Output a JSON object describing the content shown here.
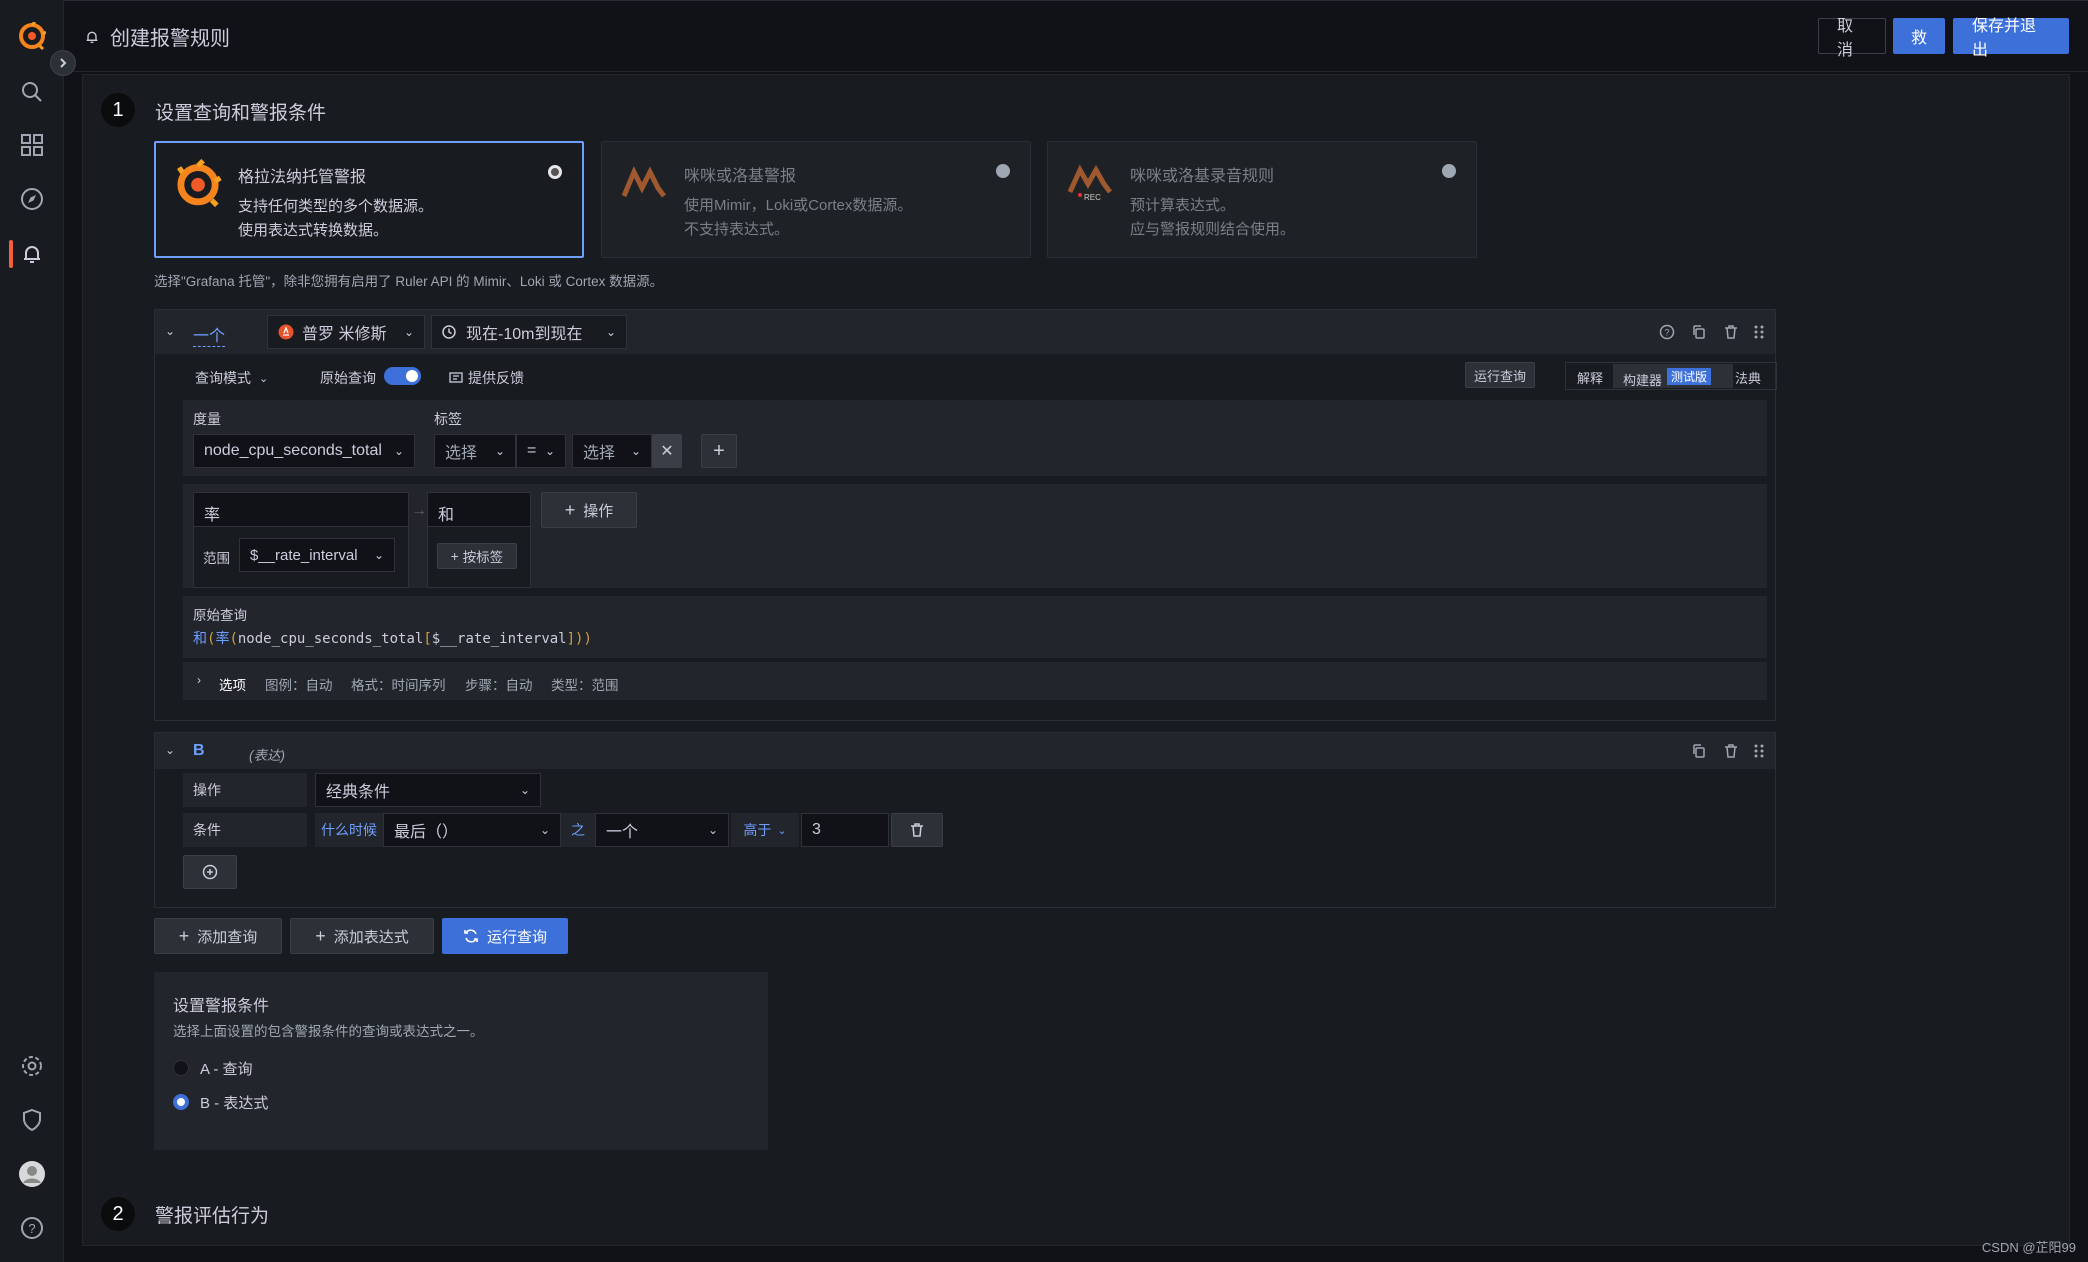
{
  "header": {
    "title": "创建报警规则",
    "cancel_label": "取消",
    "save_label": "救",
    "save_exit_label": "保存并退出"
  },
  "step1": {
    "number": "1",
    "title": "设置查询和警报条件",
    "rule_types": [
      {
        "title": "格拉法纳托管警报",
        "desc1": "支持任何类型的多个数据源。",
        "desc2": "使用表达式转换数据。"
      },
      {
        "title": "咪咪或洛基警报",
        "desc1": "使用Mimir，Loki或Cortex数据源。",
        "desc2": "不支持表达式。"
      },
      {
        "title": "咪咪或洛基录音规则",
        "desc1": "预计算表达式。",
        "desc2": "应与警报规则结合使用。",
        "badge": "REC"
      }
    ],
    "hint": "选择\"Grafana 托管\"，除非您拥有启用了 Ruler API 的 Mimir、Loki 或 Cortex 数据源。"
  },
  "queryA": {
    "name": "一个",
    "datasource": "普罗 米修斯",
    "time_range": "现在-10m到现在",
    "query_mode": "查询模式",
    "raw_query_toggle": "原始查询",
    "feedback": "提供反馈",
    "run_query": "运行查询",
    "explain": "解释",
    "builder": "构建器",
    "beta": "测试版",
    "code": "法典",
    "metric_label": "度量",
    "metric_value": "node_cpu_seconds_total",
    "labels_label": "标签",
    "label_select1": "选择",
    "label_op": "=",
    "label_select2": "选择",
    "op1_name": "率",
    "range_label": "范围",
    "range_value": "$__rate_interval",
    "op2_name": "和",
    "by_label_btn": "按标签",
    "operation_btn": "操作",
    "raw_title": "原始查询",
    "raw_fn_sum": "和",
    "raw_fn_rate": "率",
    "raw_metric": "node_cpu_seconds_total",
    "raw_range": "$__rate_interval",
    "options_label": "选项",
    "opt_legend": "图例：自动",
    "opt_format": "格式：时间序列",
    "opt_step": "步骤：自动",
    "opt_type": "类型：范围"
  },
  "exprB": {
    "name": "B",
    "type_label": "(表达)",
    "operation_label": "操作",
    "operation_value": "经典条件",
    "condition_label": "条件",
    "when": "什么时候",
    "reducer": "最后（）",
    "of": "之",
    "query": "一个",
    "evaluator": "高于",
    "threshold": "3"
  },
  "actions": {
    "add_query": "添加查询",
    "add_expression": "添加表达式",
    "run_queries": "运行查询"
  },
  "condition": {
    "title": "设置警报条件",
    "desc": "选择上面设置的包含警报条件的查询或表达式之一。",
    "option_a": "A - 查询",
    "option_b": "B - 表达式"
  },
  "step2": {
    "number": "2",
    "title": "警报评估行为"
  },
  "watermark": "CSDN @芷阳99",
  "colors": {
    "primary": "#3d71d9",
    "accent": "#f55f3e",
    "bg": "#111217"
  }
}
